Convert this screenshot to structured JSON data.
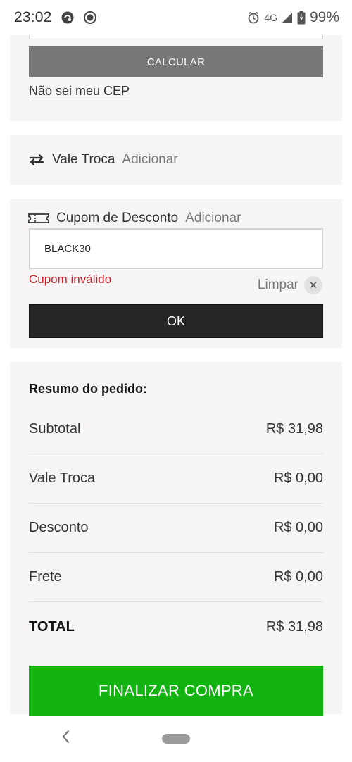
{
  "status_bar": {
    "time": "23:02",
    "network": "4G",
    "battery": "99%",
    "icons": [
      "notification-app-icon",
      "record-icon",
      "alarm-icon",
      "signal-icon",
      "battery-charging-icon"
    ]
  },
  "cep": {
    "calc_label": "CALCULAR",
    "dont_know_link": "Não sei meu CEP"
  },
  "vale_troca": {
    "icon": "swap-arrows-icon",
    "title": "Vale Troca",
    "add_label": "Adicionar"
  },
  "cupom": {
    "icon": "ticket-icon",
    "title": "Cupom de Desconto",
    "add_label": "Adicionar",
    "input_value": "BLACK30",
    "error": "Cupom inválido",
    "clear_label": "Limpar",
    "ok_label": "OK"
  },
  "resumo": {
    "title": "Resumo do pedido:",
    "rows": [
      {
        "label": "Subtotal",
        "value": "R$ 31,98"
      },
      {
        "label": "Vale Troca",
        "value": "R$ 0,00"
      },
      {
        "label": "Desconto",
        "value": "R$ 0,00"
      },
      {
        "label": "Frete",
        "value": "R$ 0,00"
      },
      {
        "label": "TOTAL",
        "value": "R$ 31,98"
      }
    ],
    "finalize_label": "FINALIZAR COMPRA"
  },
  "colors": {
    "finalize_green": "#13b312",
    "error_red": "#c8202a",
    "ok_dark": "#262626",
    "calc_gray": "#777777"
  }
}
